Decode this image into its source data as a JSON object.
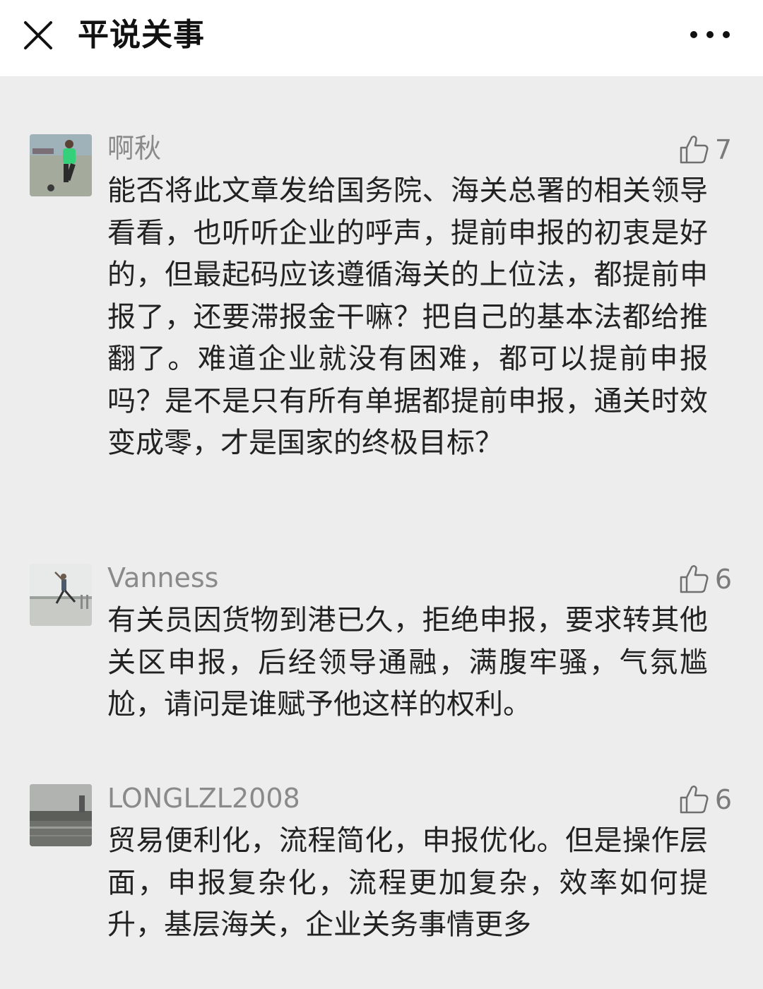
{
  "header": {
    "title": "平说关事",
    "close_icon": "close-icon",
    "more_icon": "more-icon"
  },
  "comments": [
    {
      "nickname": "啊秋",
      "likes": "7",
      "text": "能否将此文章发给国务院、海关总署的相关领导看看，也听听企业的呼声，提前申报的初衷是好的，但最起码应该遵循海关的上位法，都提前申报了，还要滞报金干嘛？把自己的基本法都给推翻了。难道企业就没有困难，都可以提前申报吗？是不是只有所有单据都提前申报，通关时效变成零，才是国家的终极目标？"
    },
    {
      "nickname": "Vanness",
      "likes": "6",
      "text": "有关员因货物到港已久，拒绝申报，要求转其他关区申报，后经领导通融，满腹牢骚，气氛尴尬，请问是谁赋予他这样的权利。"
    },
    {
      "nickname": "LONGLZL2008",
      "likes": "6",
      "text": "贸易便利化，流程简化，申报优化。但是操作层面，申报复杂化，流程更加复杂，效率如何提升，基层海关，企业关务事情更多"
    }
  ],
  "colors": {
    "background": "#ededed",
    "header_background": "#ffffff",
    "nickname": "#8a8a8a",
    "text": "#222222"
  }
}
